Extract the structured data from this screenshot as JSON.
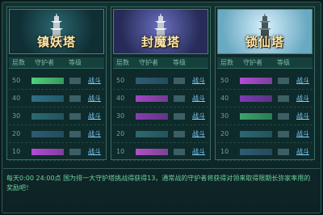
{
  "towers": [
    {
      "name": "镇妖塔",
      "headers": [
        "层数",
        "守护者",
        "等级"
      ],
      "banner_colors": [
        "#1d4751",
        "#0d2d33"
      ],
      "rows": [
        {
          "floor": "50",
          "guard_color": "#4fd07a",
          "action": "战斗"
        },
        {
          "floor": "40",
          "guard_color": "#2f6f86",
          "action": "战斗"
        },
        {
          "floor": "30",
          "guard_color": "#2d6872",
          "action": "战斗"
        },
        {
          "floor": "20",
          "guard_color": "#2e5c74",
          "action": "战斗"
        },
        {
          "floor": "10",
          "guard_color": "#b44bd6",
          "action": "战斗"
        }
      ]
    },
    {
      "name": "封魔塔",
      "headers": [
        "层数",
        "守护者",
        "等级"
      ],
      "banner_colors": [
        "#4a4f93",
        "#22284f"
      ],
      "rows": [
        {
          "floor": "50",
          "guard_color": "#2e5c74",
          "action": "战斗"
        },
        {
          "floor": "40",
          "guard_color": "#a446c2",
          "action": "战斗"
        },
        {
          "floor": "30",
          "guard_color": "#8a3cb0",
          "action": "战斗"
        },
        {
          "floor": "20",
          "guard_color": "#2d6872",
          "action": "战斗"
        },
        {
          "floor": "10",
          "guard_color": "#b24fc9",
          "action": "战斗"
        }
      ]
    },
    {
      "name": "锁仙塔",
      "headers": [
        "层数",
        "守护者",
        "等级"
      ],
      "banner_colors": [
        "#b5dff1",
        "#6aa9c2"
      ],
      "rows": [
        {
          "floor": "50",
          "guard_color": "#b44bd6",
          "action": "战斗"
        },
        {
          "floor": "40",
          "guard_color": "#7b3bb1",
          "action": "战斗"
        },
        {
          "floor": "30",
          "guard_color": "#3ca36b",
          "action": "战斗"
        },
        {
          "floor": "20",
          "guard_color": "#2d6872",
          "action": "战斗"
        },
        {
          "floor": "10",
          "guard_color": "#2e5c74",
          "action": "战斗"
        }
      ]
    }
  ],
  "footer_text": "每天0:00 24:00点 国为排一大守护塔挑战得获得13，通常战的守护者将获得对领来取得限期长弥家率用的奖励吧！"
}
